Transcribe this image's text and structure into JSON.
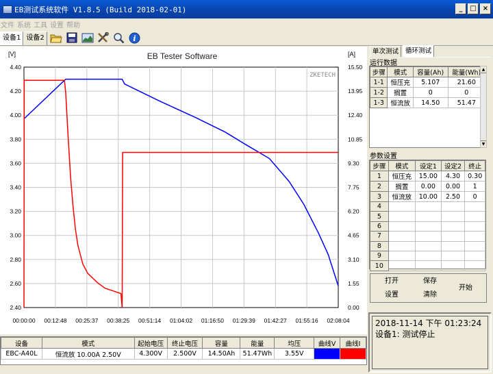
{
  "window": {
    "title": "EB测试系统软件 V1.8.5 (Build 2018-02-01)",
    "btn_min": "_",
    "btn_max": "□",
    "btn_close": "×"
  },
  "menu": [
    "文件",
    "系统",
    "工具",
    "设置",
    "帮助"
  ],
  "device_tabs": [
    "设备1",
    "设备2"
  ],
  "toolbar_icons": [
    "folder-open-icon",
    "save-icon",
    "chart-image-icon",
    "tools-icon",
    "magnifier-icon",
    "info-icon"
  ],
  "colors": {
    "voltage": "#0000ff",
    "current": "#ff0000",
    "titlebar": "#0a4fc4"
  },
  "chart_data": {
    "type": "line",
    "title": "EB Tester Software",
    "watermark": "ZKETECH",
    "left_unit": "[V]",
    "right_unit": "[A]",
    "ylim": [
      2.4,
      4.4
    ],
    "y2lim": [
      0.0,
      15.5
    ],
    "left_ticks": [
      "4.40",
      "4.20",
      "4.00",
      "3.80",
      "3.60",
      "3.40",
      "3.20",
      "3.00",
      "2.80",
      "2.60",
      "2.40"
    ],
    "right_ticks": [
      "15.50",
      "13.95",
      "12.40",
      "10.85",
      "9.30",
      "7.75",
      "6.20",
      "4.65",
      "3.10",
      "1.55",
      "0.00"
    ],
    "x_ticks": [
      "00:00:00",
      "00:12:48",
      "00:25:37",
      "00:38:25",
      "00:51:14",
      "01:04:02",
      "01:16:50",
      "01:29:39",
      "01:42:27",
      "01:55:16",
      "02:08:04"
    ],
    "xlim_minutes": [
      0,
      128.07
    ],
    "grid": true,
    "series": [
      {
        "name": "曲线V",
        "axis": "left",
        "x": [
          0,
          17,
          40,
          41,
          55,
          70,
          82,
          90,
          100,
          108,
          114,
          120,
          124,
          128.07
        ],
        "y": [
          3.97,
          4.3,
          4.3,
          4.26,
          4.12,
          3.98,
          3.86,
          3.76,
          3.64,
          3.45,
          3.26,
          3.02,
          2.84,
          2.58
        ]
      },
      {
        "name": "曲线I",
        "axis": "right",
        "x": [
          0,
          0.1,
          16.5,
          17,
          18,
          19,
          20,
          21,
          22,
          24,
          26,
          30,
          33,
          39.5,
          40,
          40.2,
          128.07
        ],
        "y": [
          0.0,
          14.65,
          14.65,
          13.9,
          11.0,
          8.4,
          6.5,
          5.0,
          4.0,
          2.8,
          2.2,
          1.6,
          1.25,
          0.9,
          0.0,
          10.0,
          10.0
        ]
      }
    ]
  },
  "panel": {
    "tabs": [
      "单次测试",
      "循环测试"
    ],
    "run_header": "运行数据",
    "run_columns": [
      "步骤",
      "模式",
      "容量(Ah)",
      "能量(Wh)"
    ],
    "run_rows": [
      [
        "1-1",
        "恒压充",
        "5.107",
        "21.60"
      ],
      [
        "1-2",
        "搁置",
        "0",
        "0"
      ],
      [
        "1-3",
        "恒流放",
        "14.50",
        "51.47"
      ]
    ],
    "param_header": "参数设置",
    "param_columns": [
      "步骤",
      "模式",
      "设定1",
      "设定2",
      "终止"
    ],
    "param_rows": [
      [
        "1",
        "恒压充",
        "15.00",
        "4.30",
        "0.30"
      ],
      [
        "2",
        "搁置",
        "0.00",
        "0.00",
        "1"
      ],
      [
        "3",
        "恒流放",
        "10.00",
        "2.50",
        "0"
      ],
      [
        "4",
        "",
        "",
        "",
        ""
      ],
      [
        "5",
        "",
        "",
        "",
        ""
      ],
      [
        "6",
        "",
        "",
        "",
        ""
      ],
      [
        "7",
        "",
        "",
        "",
        ""
      ],
      [
        "8",
        "",
        "",
        "",
        ""
      ],
      [
        "9",
        "",
        "",
        "",
        ""
      ],
      [
        "10",
        "",
        "",
        "",
        ""
      ]
    ],
    "buttons": {
      "open": "打开",
      "save": "保存",
      "settings": "设置",
      "clear": "清除",
      "start": "开始"
    }
  },
  "status": {
    "datetime": "2018-11-14 下午 01:23:24",
    "state": "设备1: 测试停止"
  },
  "summary": {
    "columns": [
      "设备",
      "模式",
      "起始电压",
      "终止电压",
      "容量",
      "能量",
      "均压",
      "曲线V",
      "曲线I"
    ],
    "row": [
      "EBC-A40L",
      "恒流放 10.00A 2.50V",
      "4.300V",
      "2.500V",
      "14.50Ah",
      "51.47Wh",
      "3.55V"
    ]
  }
}
